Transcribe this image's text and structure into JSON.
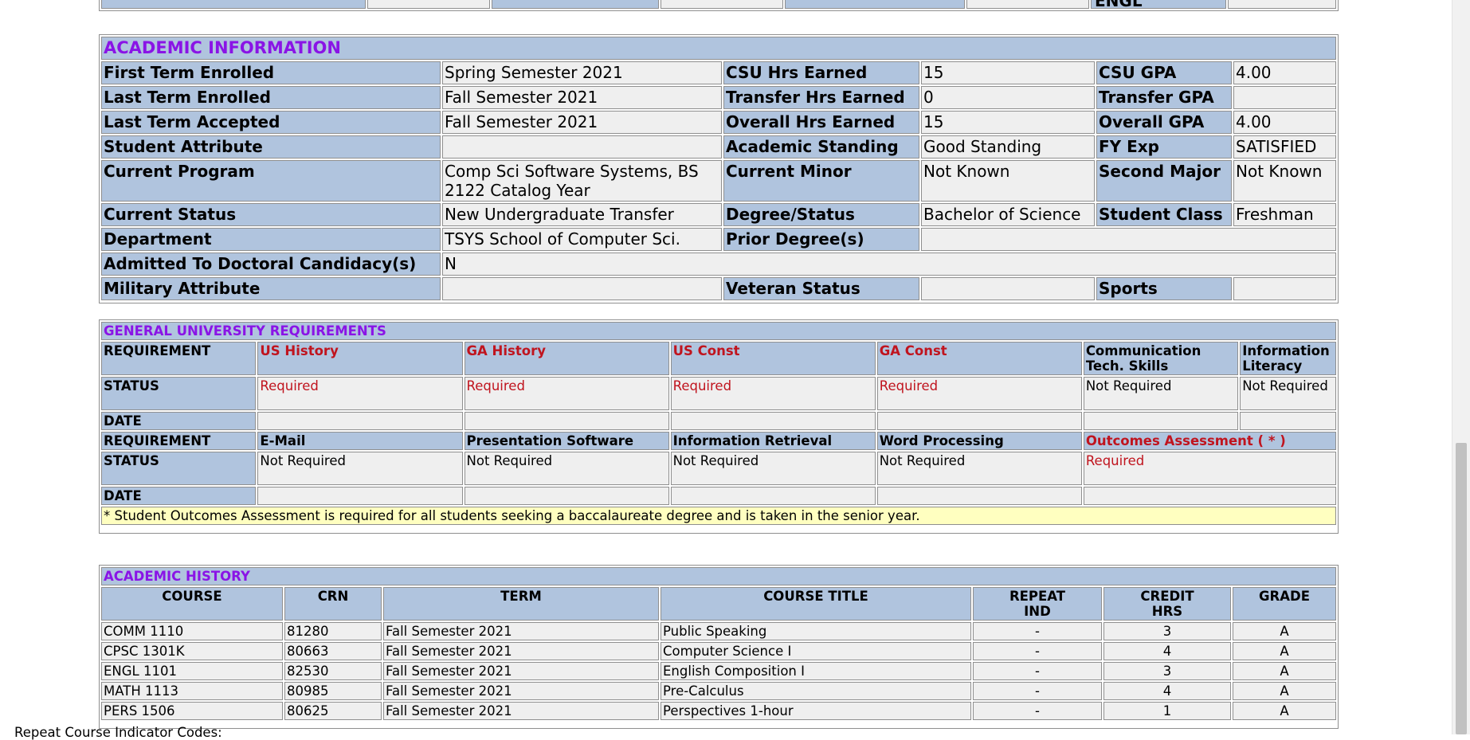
{
  "top_partial": {
    "fragment": "ENGL"
  },
  "academic_information": {
    "title": "ACADEMIC INFORMATION",
    "rows": [
      [
        "First Term Enrolled",
        "Spring Semester 2021",
        "CSU Hrs Earned",
        "15",
        "CSU GPA",
        "4.00"
      ],
      [
        "Last Term Enrolled",
        "Fall Semester 2021",
        "Transfer Hrs Earned",
        "0",
        "Transfer GPA",
        ""
      ],
      [
        "Last Term Accepted",
        "Fall Semester 2021",
        "Overall Hrs Earned",
        "15",
        "Overall GPA",
        "4.00"
      ],
      [
        "Student Attribute",
        "",
        "Academic Standing",
        "Good Standing",
        "FY Exp",
        "SATISFIED"
      ]
    ],
    "current_program": {
      "label": "Current Program",
      "line1": "Comp Sci Software Systems, BS",
      "line2": "2122 Catalog Year",
      "minor_label": "Current Minor",
      "minor_value": "Not Known",
      "second_major_label": "Second Major",
      "second_major_value": "Not Known"
    },
    "current_status": {
      "label": "Current Status",
      "value": "New Undergraduate Transfer",
      "degree_label": "Degree/Status",
      "degree_value": "Bachelor of Science",
      "class_label": "Student Class",
      "class_value": "Freshman"
    },
    "department": {
      "label": "Department",
      "value": "TSYS School of Computer Sci.",
      "prior_label": "Prior Degree(s)",
      "prior_value": ""
    },
    "doctoral": {
      "label": "Admitted To Doctoral Candidacy(s)",
      "value": "N"
    },
    "military": {
      "label": "Military Attribute",
      "value": "",
      "veteran_label": "Veteran Status",
      "veteran_value": "",
      "sports_label": "Sports",
      "sports_value": ""
    }
  },
  "general_requirements": {
    "title": "GENERAL UNIVERSITY REQUIREMENTS",
    "row_labels": {
      "requirement": "REQUIREMENT",
      "status": "STATUS",
      "date": "DATE"
    },
    "group1": {
      "requirements": [
        {
          "name": "US History",
          "required": true
        },
        {
          "name": "GA History",
          "required": true
        },
        {
          "name": "US Const",
          "required": true
        },
        {
          "name": "GA Const",
          "required": true
        },
        {
          "name": "Communication Tech. Skills",
          "required": false
        },
        {
          "name": "Information Literacy",
          "required": false
        }
      ],
      "status": [
        "Required",
        "Required",
        "Required",
        "Required",
        "Not Required",
        "Not Required"
      ]
    },
    "group2": {
      "requirements": [
        {
          "name": "E-Mail",
          "required": false
        },
        {
          "name": "Presentation Software",
          "required": false
        },
        {
          "name": "Information Retrieval",
          "required": false
        },
        {
          "name": "Word Processing",
          "required": false
        },
        {
          "name": "Outcomes Assessment ( * )",
          "required": true
        }
      ],
      "status": [
        "Not Required",
        "Not Required",
        "Not Required",
        "Not Required",
        "Required"
      ]
    },
    "note": "* Student Outcomes Assessment is required for all students seeking a baccalaureate degree and is taken in the senior year."
  },
  "academic_history": {
    "title": "ACADEMIC HISTORY",
    "headers": {
      "course": "COURSE",
      "crn": "CRN",
      "term": "TERM",
      "title": "COURSE TITLE",
      "repeat_1": "REPEAT",
      "repeat_2": "IND",
      "credit_1": "CREDIT",
      "credit_2": "HRS",
      "grade": "GRADE"
    },
    "rows": [
      {
        "course": "COMM 1110",
        "crn": "81280",
        "term": "Fall Semester 2021",
        "title": "Public Speaking",
        "repeat": "-",
        "credit": "3",
        "grade": "A"
      },
      {
        "course": "CPSC 1301K",
        "crn": "80663",
        "term": "Fall Semester 2021",
        "title": "Computer Science I",
        "repeat": "-",
        "credit": "4",
        "grade": "A"
      },
      {
        "course": "ENGL 1101",
        "crn": "82530",
        "term": "Fall Semester 2021",
        "title": "English Composition I",
        "repeat": "-",
        "credit": "3",
        "grade": "A"
      },
      {
        "course": "MATH 1113",
        "crn": "80985",
        "term": "Fall Semester 2021",
        "title": "Pre-Calculus",
        "repeat": "-",
        "credit": "4",
        "grade": "A"
      },
      {
        "course": "PERS 1506",
        "crn": "80625",
        "term": "Fall Semester 2021",
        "title": "Perspectives 1-hour",
        "repeat": "-",
        "credit": "1",
        "grade": "A"
      }
    ]
  },
  "footer": {
    "text": "Repeat Course Indicator Codes:"
  },
  "colors": {
    "label_bg": "#b0c4de",
    "value_bg": "#efefef",
    "section_title": "#8a14e6",
    "required_red": "#c0141e",
    "note_bg": "#ffffc0"
  }
}
